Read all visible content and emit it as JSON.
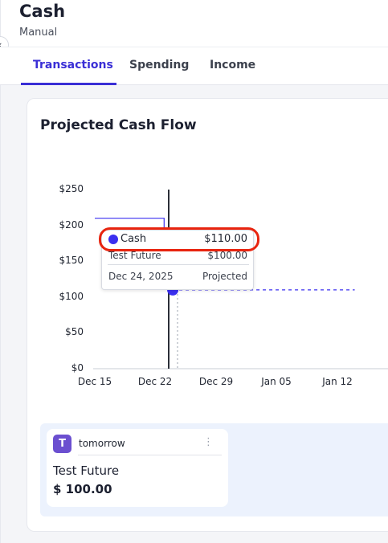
{
  "header": {
    "title": "Cash",
    "subtitle": "Manual"
  },
  "tabs": [
    {
      "label": "Transactions",
      "active": true
    },
    {
      "label": "Spending",
      "active": false
    },
    {
      "label": "Income",
      "active": false
    }
  ],
  "card": {
    "title": "Projected Cash Flow"
  },
  "chart_data": {
    "type": "line",
    "title": "Projected Cash Flow",
    "xlabel": "",
    "ylabel": "",
    "y_ticks": [
      "$250",
      "$200",
      "$150",
      "$100",
      "$50",
      "$0"
    ],
    "ylim": [
      0,
      250
    ],
    "x_ticks": [
      "Dec 15",
      "Dec 22",
      "Dec 29",
      "Jan 05",
      "Jan 12"
    ],
    "series": [
      {
        "name": "Cash",
        "color": "#3a2ff0",
        "actual": [
          {
            "x": "Dec 15",
            "y": 210
          },
          {
            "x": "Dec 23",
            "y": 210
          }
        ],
        "projected": [
          {
            "x": "Dec 24",
            "y": 110
          },
          {
            "x": "Jan 14",
            "y": 110
          }
        ]
      }
    ],
    "tooltip": {
      "series": "Cash",
      "value": "$110.00",
      "sub_name": "Test Future",
      "sub_value": "$100.00",
      "date": "Dec 24, 2025",
      "status": "Projected"
    },
    "grid": false
  },
  "transaction": {
    "avatar_letter": "T",
    "when": "tomorrow",
    "menu_icon": "⋮",
    "name": "Test Future",
    "amount": "$ 100.00"
  },
  "colors": {
    "accent": "#3a2fd6",
    "highlight": "#e8240f",
    "avatar": "#6b4fd0"
  }
}
